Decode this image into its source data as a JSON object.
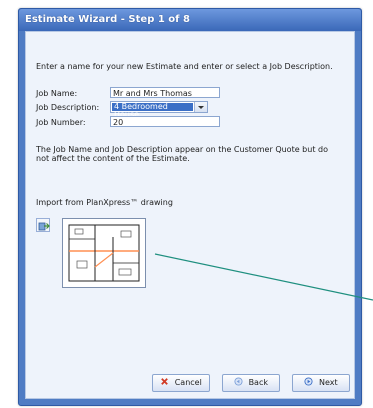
{
  "window": {
    "title": "Estimate Wizard - Step 1 of 8"
  },
  "main": {
    "instruction": "Enter a name for your new Estimate and enter or select a Job Description.",
    "fields": {
      "job_name_label": "Job Name:",
      "job_name_value": "Mr and Mrs Thomas",
      "job_description_label": "Job Description:",
      "job_description_value": "4 Bedroomed House",
      "job_number_label": "Job Number:",
      "job_number_value": "20"
    },
    "note": "The Job Name and Job Description appear on the Customer Quote but do not affect the content of the Estimate.",
    "import_label": "Import from PlanXpress™ drawing"
  },
  "buttons": {
    "cancel": "Cancel",
    "back": "Back",
    "next": "Next"
  },
  "icons": {
    "import": "import-icon",
    "cancel": "x-icon",
    "back": "back-icon",
    "next": "next-icon"
  },
  "colors": {
    "title_bar": "#4f7cc4",
    "client_bg": "#eef3fb",
    "selected_value_bg": "#3b6fc6",
    "annotation_line": "#1e8f7f"
  }
}
